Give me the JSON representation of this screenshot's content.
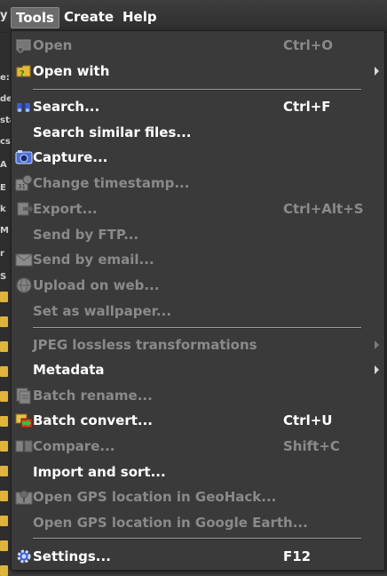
{
  "menubar": {
    "edge": "y",
    "items": [
      {
        "label": "Tools",
        "active": true
      },
      {
        "label": "Create",
        "active": false
      },
      {
        "label": "Help",
        "active": false
      }
    ]
  },
  "background": {
    "fragments": [
      "e:",
      "de",
      "sta",
      "cs",
      "A",
      "E",
      "k",
      "M",
      "r",
      "S"
    ]
  },
  "menu": {
    "items": [
      {
        "label": "Open",
        "shortcut": "Ctrl+O",
        "enabled": false,
        "icon": "open-icon"
      },
      {
        "label": "Open with",
        "shortcut": "",
        "enabled": true,
        "submenu": true,
        "icon": "open-with-icon"
      },
      {
        "label": "Search...",
        "shortcut": "Ctrl+F",
        "enabled": true,
        "icon": "binoculars-icon"
      },
      {
        "label": "Search similar files...",
        "shortcut": "",
        "enabled": true,
        "icon": ""
      },
      {
        "label": "Capture...",
        "shortcut": "",
        "enabled": true,
        "icon": "camera-icon"
      },
      {
        "label": "Change timestamp...",
        "shortcut": "",
        "enabled": false,
        "icon": "calendar-clock-icon"
      },
      {
        "label": "Export...",
        "shortcut": "Ctrl+Alt+S",
        "enabled": false,
        "icon": "export-icon"
      },
      {
        "label": "Send by FTP...",
        "shortcut": "",
        "enabled": false,
        "icon": ""
      },
      {
        "label": "Send by email...",
        "shortcut": "",
        "enabled": false,
        "icon": "envelope-icon"
      },
      {
        "label": "Upload on web...",
        "shortcut": "",
        "enabled": false,
        "icon": "globe-icon"
      },
      {
        "label": "Set as wallpaper...",
        "shortcut": "",
        "enabled": false,
        "icon": ""
      },
      {
        "label": "JPEG lossless transformations",
        "shortcut": "",
        "enabled": false,
        "submenu": true,
        "icon": ""
      },
      {
        "label": "Metadata",
        "shortcut": "",
        "enabled": true,
        "submenu": true,
        "icon": ""
      },
      {
        "label": "Batch rename...",
        "shortcut": "",
        "enabled": false,
        "icon": "batch-rename-icon"
      },
      {
        "label": "Batch convert...",
        "shortcut": "Ctrl+U",
        "enabled": true,
        "icon": "batch-convert-icon"
      },
      {
        "label": "Compare...",
        "shortcut": "Shift+C",
        "enabled": false,
        "icon": "compare-icon"
      },
      {
        "label": "Import and sort...",
        "shortcut": "",
        "enabled": true,
        "icon": ""
      },
      {
        "label": "Open GPS location in GeoHack...",
        "shortcut": "",
        "enabled": false,
        "icon": "gps-icon"
      },
      {
        "label": "Open GPS location in Google Earth...",
        "shortcut": "",
        "enabled": false,
        "icon": ""
      },
      {
        "label": "Settings...",
        "shortcut": "F12",
        "enabled": true,
        "icon": "gear-icon"
      }
    ]
  }
}
